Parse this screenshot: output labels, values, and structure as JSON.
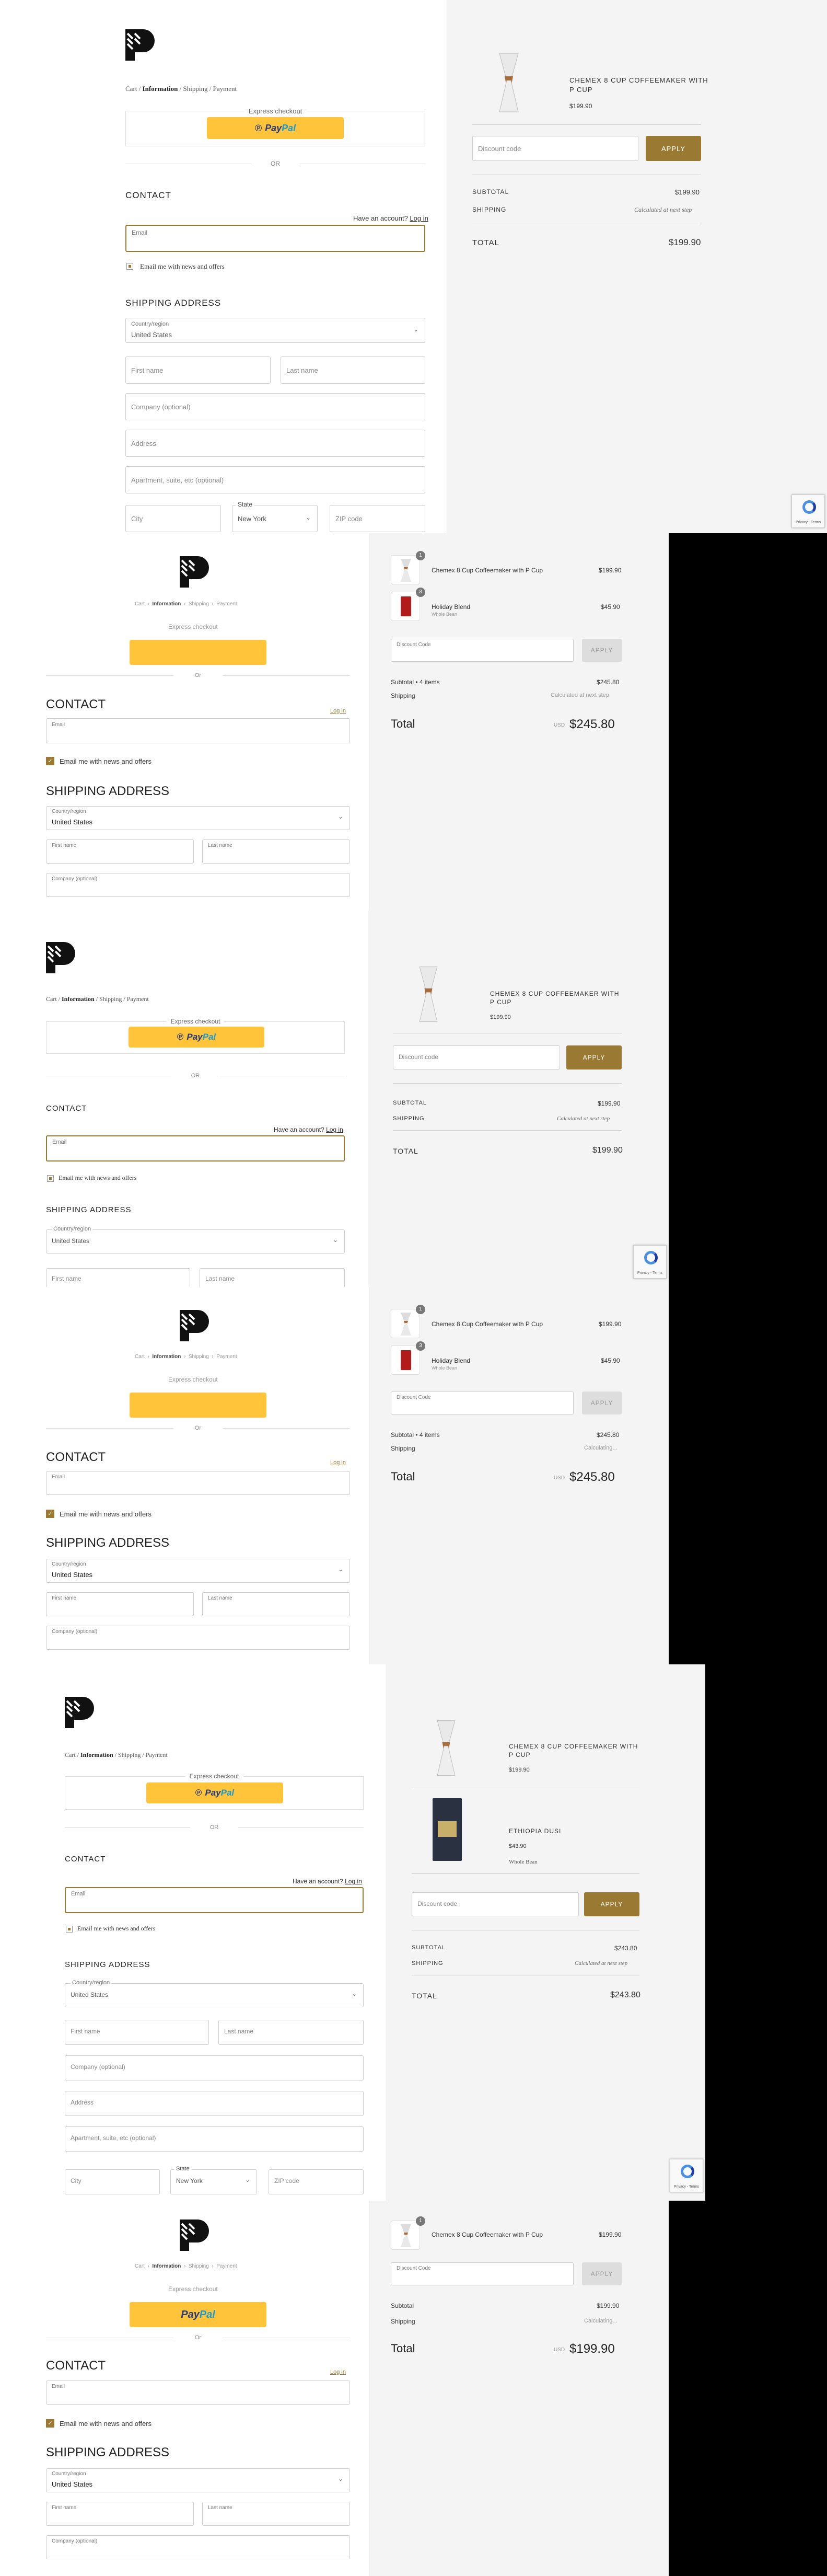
{
  "checkout": {
    "breadcrumb": {
      "cart": "Cart",
      "information": "Information",
      "shipping": "Shipping",
      "payment": "Payment",
      "sep": "/",
      "sep2": "›"
    },
    "express_checkout": "Express checkout",
    "paypal_a": "Pay",
    "paypal_b": "Pal",
    "or": "OR",
    "or_lower": "Or",
    "contact": "CONTACT",
    "have_account": "Have an account?",
    "log_in": "Log in",
    "email_label": "Email",
    "email_news": "Email me with news and offers",
    "shipping_address": "SHIPPING ADDRESS",
    "country_label": "Country/region",
    "country_value": "United States",
    "first_name": "First name",
    "last_name": "Last name",
    "company": "Company (optional)",
    "address": "Address",
    "apartment": "Apartment, suite, etc (optional)",
    "city": "City",
    "state_label": "State",
    "state_value": "New York",
    "zip": "ZIP code"
  },
  "summary": {
    "chemex_upper": "CHEMEX 8 CUP COFFEEMAKER WITH P CUP",
    "chemex_line1": "CHEMEX 8 CUP COFFEEMAKER WITH",
    "chemex_line2": "P CUP",
    "chemex_title": "Chemex 8 Cup Coffeemaker with P Cup",
    "chemex_price": "$199.90",
    "holiday_title": "Holiday Blend",
    "holiday_sub": "Whole Bean",
    "holiday_price": "$45.90",
    "ethiopia_title": "ETHIOPIA DUSI",
    "ethiopia_price": "$43.90",
    "ethiopia_sub": "Whole Bean",
    "qty_1": "1",
    "qty_3": "3",
    "discount_placeholder": "Discount code",
    "discount_label": "Discount Code",
    "apply": "APPLY",
    "subtotal_upper": "SUBTOTAL",
    "shipping_upper": "SHIPPING",
    "total_upper": "TOTAL",
    "subtotal_items": "Subtotal • 4 items",
    "subtotal_plain": "Subtotal",
    "shipping_plain": "Shipping",
    "total_plain": "Total",
    "calc_next": "Calculated at next step",
    "calculating": "Calculating...",
    "subtotal_199": "$199.90",
    "subtotal_245": "$245.80",
    "subtotal_243": "$243.80",
    "total_199": "$199.90",
    "total_243": "$243.80",
    "currency": "USD",
    "total_245": "$245.80"
  },
  "recaptcha_text": "Privacy - Terms",
  "colors": {
    "accent": "#9a7a32",
    "paypal": "#ffc439",
    "panel_bg": "#f4f4f4"
  }
}
